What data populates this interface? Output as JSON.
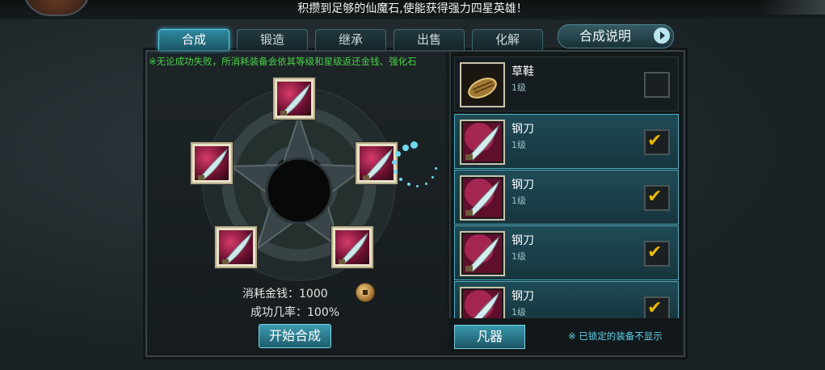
{
  "notice": "积攒到足够的仙魔石,使能获得强力四星英雄！",
  "tabs": [
    {
      "label": "合成",
      "active": true
    },
    {
      "label": "锻造",
      "active": false
    },
    {
      "label": "继承",
      "active": false
    },
    {
      "label": "出售",
      "active": false
    },
    {
      "label": "化解",
      "active": false
    }
  ],
  "help_button": "合成说明",
  "hint": "※无论成功失败，所消耗装备会依其等级和星级返还金钱、强化石",
  "synth": {
    "cost_label": "消耗金钱：1000",
    "rate_label": "成功几率：100%",
    "start_button": "开始合成"
  },
  "items": [
    {
      "name": "草鞋",
      "level": "1级",
      "checked": false,
      "icon": "straw-sandal-icon"
    },
    {
      "name": "钢刀",
      "level": "1级",
      "checked": true,
      "icon": "steel-blade-icon"
    },
    {
      "name": "钢刀",
      "level": "1级",
      "checked": true,
      "icon": "steel-blade-icon"
    },
    {
      "name": "钢刀",
      "level": "1级",
      "checked": true,
      "icon": "steel-blade-icon"
    },
    {
      "name": "钢刀",
      "level": "1级",
      "checked": true,
      "icon": "steel-blade-icon"
    }
  ],
  "category_button": "凡器",
  "lock_note": "※ 已锁定的装备不显示",
  "check_mark": "✔"
}
